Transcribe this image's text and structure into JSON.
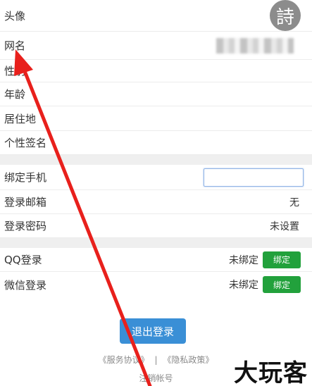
{
  "profile": {
    "avatar_label": "头像",
    "avatar_char": "詩",
    "nickname_label": "网名",
    "gender_label": "性别",
    "age_label": "年龄",
    "residence_label": "居住地",
    "signature_label": "个性签名"
  },
  "account": {
    "phone_label": "绑定手机",
    "phone_value": "",
    "email_label": "登录邮箱",
    "email_value": "无",
    "password_label": "登录密码",
    "password_value": "未设置"
  },
  "social": {
    "qq_label": "QQ登录",
    "qq_status": "未绑定",
    "qq_button": "绑定",
    "wechat_label": "微信登录",
    "wechat_status": "未绑定",
    "wechat_button": "绑定"
  },
  "actions": {
    "logout": "退出登录",
    "service_agreement": "《服务协议》",
    "separator": "|",
    "privacy_policy": "《隐私政策》",
    "cancel_account": "注销帐号"
  },
  "watermark": "大玩客",
  "colors": {
    "bind_button": "#22a13c",
    "logout_button": "#3a8fd6",
    "arrow": "#e8201c"
  }
}
